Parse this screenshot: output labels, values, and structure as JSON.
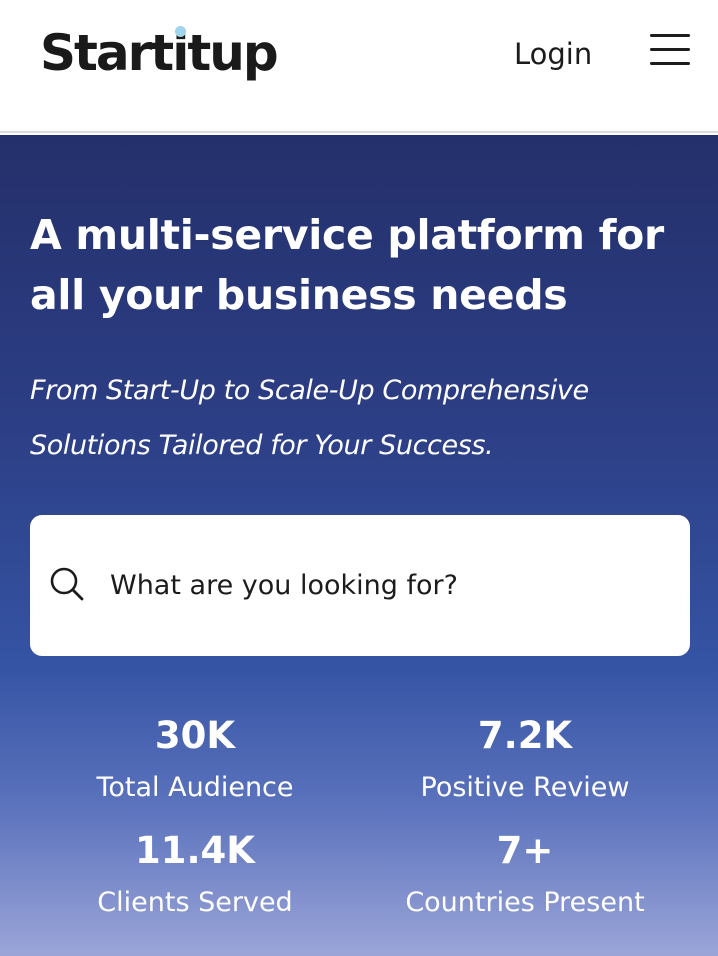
{
  "header": {
    "logo": {
      "text_before": "Start",
      "text_i": "i",
      "text_after": "tup",
      "dot_color": "#9fd4ea"
    },
    "login_label": "Login",
    "menu_icon": "hamburger-menu-icon"
  },
  "hero": {
    "title": "A multi-service platform for all your business needs",
    "subtitle": "From Start-Up to Scale-Up Comprehensive Solutions Tailored for Your Success.",
    "search": {
      "placeholder": "What are you looking for?",
      "value": "",
      "icon": "search-icon"
    },
    "stats": [
      {
        "value": "30K",
        "label": "Total Audience"
      },
      {
        "value": "7.2K",
        "label": "Positive Review"
      },
      {
        "value": "11.4K",
        "label": "Clients Served"
      },
      {
        "value": "7+",
        "label": "Countries Present"
      }
    ]
  },
  "colors": {
    "hero_top": "#24306b",
    "hero_bottom": "#9ba5d8",
    "text_dark": "#1c1c1c",
    "text_light": "#ffffff"
  }
}
